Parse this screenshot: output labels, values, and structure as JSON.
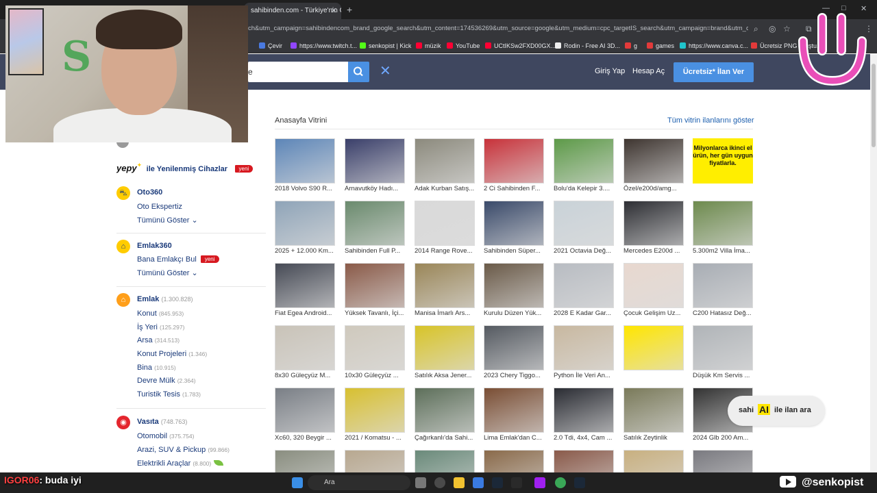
{
  "browser": {
    "tab_title": "sahibinden.com - Türkiye'nin O",
    "tab_close": "✕",
    "new_tab": "+",
    "url": "ch&utm_campaign=sahibindencom_brand_google_search&utm_content=174536269&utm_source=google&utm_medium=cpc_targetIS_search&utm_campaign=brand&utm_c...",
    "bookmarks": [
      {
        "label": "Çevir",
        "color": "#4a7ae0"
      },
      {
        "label": "https://www.twitch.t...",
        "color": "#9146ff"
      },
      {
        "label": "senkopist | Kick",
        "color": "#53fc18"
      },
      {
        "label": "müzik",
        "color": "#ff0033"
      },
      {
        "label": "YouTube",
        "color": "#ff0033"
      },
      {
        "label": "UCtIKSw2FXD00GX...",
        "color": "#ff0033"
      },
      {
        "label": "Rodin - Free AI 3D...",
        "color": "#eeeeee"
      },
      {
        "label": "g",
        "color": "#e23a3a"
      },
      {
        "label": "games",
        "color": "#e23a3a"
      },
      {
        "label": "https://www.canva.c...",
        "color": "#20c4cb"
      },
      {
        "label": "Ücretsiz PNG Oluştu...",
        "color": "#e23a3a"
      }
    ]
  },
  "header": {
    "search_value": "e",
    "login": "Giriş Yap",
    "register": "Hesap Aç",
    "post_ad": "Ücretsiz* İlan Ver",
    "clear": "✕"
  },
  "sidebar": {
    "yepy_logo": "yepy",
    "yepy_text": "ile Yenilenmiş Cihazlar",
    "new_badge": "yeni",
    "oto360": {
      "title": "Oto360",
      "items": [
        "Oto Ekspertiz",
        "Tümünü Göster"
      ]
    },
    "emlak360": {
      "title": "Emlak360",
      "items": [
        "Bana Emlakçı Bul",
        "Tümünü Göster"
      ]
    },
    "emlak": {
      "title": "Emlak",
      "count": "(1.300.828)",
      "items": [
        {
          "label": "Konut",
          "count": "(845.953)"
        },
        {
          "label": "İş Yeri",
          "count": "(125.297)"
        },
        {
          "label": "Arsa",
          "count": "(314.513)"
        },
        {
          "label": "Konut Projeleri",
          "count": "(1.346)"
        },
        {
          "label": "Bina",
          "count": "(10.915)"
        },
        {
          "label": "Devre Mülk",
          "count": "(2.364)"
        },
        {
          "label": "Turistik Tesis",
          "count": "(1.783)"
        }
      ]
    },
    "vasita": {
      "title": "Vasıta",
      "count": "(748.763)",
      "items": [
        {
          "label": "Otomobil",
          "count": "(375.754)"
        },
        {
          "label": "Arazi, SUV & Pickup",
          "count": "(99.866)"
        },
        {
          "label": "Elektrikli Araçlar",
          "count": "(8.800)"
        }
      ]
    }
  },
  "vitrin": {
    "title": "Anasayfa Vitrini",
    "show_all": "Tüm vitrin ilanlarını göster",
    "ad_text": "Milyonlarca ikinci el ürün, her gün uygun fiyatlarla.",
    "items": [
      {
        "caption": "2018 Volvo S90 R...",
        "color": "#5d86b8"
      },
      {
        "caption": "Arnavutköy Hadı...",
        "color": "#3a3f6a"
      },
      {
        "caption": "Adak Kurban Satış...",
        "color": "#8c8a7d"
      },
      {
        "caption": "2 Ci Sahibinden F...",
        "color": "#c8323a"
      },
      {
        "caption": "Bolu'da Kelepir 3....",
        "color": "#5d9a48"
      },
      {
        "caption": "Özel/e200d/amg...",
        "color": "#3e3530"
      },
      {
        "caption": "",
        "color": "#ffee00"
      },
      {
        "caption": "2025 + 12.000 Km...",
        "color": "#8fa4b8"
      },
      {
        "caption": "Sahibinden Full P...",
        "color": "#6a8a6d"
      },
      {
        "caption": "2014 Range Rove...",
        "color": "#d9d9d9"
      },
      {
        "caption": "Sahibinden Süper...",
        "color": "#3a4a6a"
      },
      {
        "caption": "2021 Octavia Değ...",
        "color": "#c9d2d8"
      },
      {
        "caption": "Mercedes E200d ...",
        "color": "#2d2e33"
      },
      {
        "caption": "5.300m2 Villa İma...",
        "color": "#6d8a4d"
      },
      {
        "caption": "Fiat Egea Android...",
        "color": "#464a55"
      },
      {
        "caption": "Yüksek Tavanlı, İçi...",
        "color": "#8a5a48"
      },
      {
        "caption": "Manisa İmarlı Ars...",
        "color": "#9a8658"
      },
      {
        "caption": "Kurulu Düzen Yük...",
        "color": "#6a5a48"
      },
      {
        "caption": "2028 E Kadar Gar...",
        "color": "#b8bcc2"
      },
      {
        "caption": "Çocuk Gelişim Uz...",
        "color": "#e8d8cf"
      },
      {
        "caption": "C200 Hatasız Değ...",
        "color": "#a8adb4"
      },
      {
        "caption": "8x30 Güleçyüz M...",
        "color": "#c9c3b8"
      },
      {
        "caption": "10x30 Güleçyüz ...",
        "color": "#cfc9bd"
      },
      {
        "caption": "Satılık Aksa Jener...",
        "color": "#d8c428"
      },
      {
        "caption": "2023 Chery Tiggo...",
        "color": "#555a61"
      },
      {
        "caption": "Python İle Veri An...",
        "color": "#c8b8a0"
      },
      {
        "caption": "",
        "color": "#ffe600"
      },
      {
        "caption": "Düşük Km Servis ...",
        "color": "#b0b4b8"
      },
      {
        "caption": "Xc60, 320 Beygir ...",
        "color": "#7a7f86"
      },
      {
        "caption": "2021 / Komatsu - ...",
        "color": "#d8c030"
      },
      {
        "caption": "Çağırkanlı'da Sahi...",
        "color": "#5d6f5a"
      },
      {
        "caption": "Lima Emlak'dan C...",
        "color": "#7a4e34"
      },
      {
        "caption": "2.0 Tdi, 4x4, Cam ...",
        "color": "#2a2c33"
      },
      {
        "caption": "Satılık Zeytinlik",
        "color": "#7a7a5a"
      },
      {
        "caption": "2024 Glb 200 Am...",
        "color": "#333333"
      },
      {
        "caption": "",
        "color": "#8a8e80"
      },
      {
        "caption": "",
        "color": "#b8a890"
      },
      {
        "caption": "",
        "color": "#6a8a7a"
      },
      {
        "caption": "",
        "color": "#8a6a4a"
      },
      {
        "caption": "",
        "color": "#8a5a4a"
      },
      {
        "caption": "",
        "color": "#c8b080"
      },
      {
        "caption": "",
        "color": "#7a7a80"
      }
    ]
  },
  "ai_button": {
    "prefix": "sahi",
    "ai": "AI",
    "suffix": "ile ilan ara"
  },
  "taskbar": {
    "search": "Ara"
  },
  "overlay": {
    "chat_user": "IGOR06",
    "chat_msg": ": buda iyi",
    "youtube_handle": "@senkopist"
  }
}
